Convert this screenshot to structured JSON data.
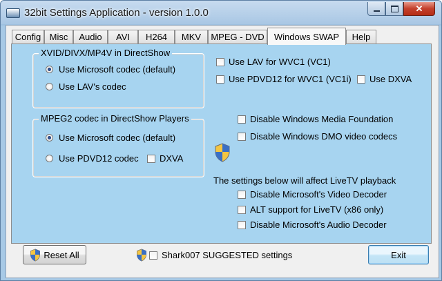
{
  "window": {
    "title": "32bit Settings Application - version 1.0.0",
    "close_label": "✕"
  },
  "tabs": [
    {
      "label": "Config"
    },
    {
      "label": "Misc"
    },
    {
      "label": "Audio"
    },
    {
      "label": "AVI"
    },
    {
      "label": "H264"
    },
    {
      "label": "MKV"
    },
    {
      "label": "MPEG - DVD"
    },
    {
      "label": "Windows SWAP",
      "active": true
    },
    {
      "label": "Help"
    }
  ],
  "xvid_group": {
    "title": "XVID/DIVX/MP4V in DirectShow",
    "options": [
      {
        "label": "Use Microsoft codec (default)",
        "selected": true
      },
      {
        "label": "Use LAV's codec",
        "selected": false
      }
    ]
  },
  "mpeg2_group": {
    "title": "MPEG2 codec in DirectShow Players",
    "options": [
      {
        "label": "Use Microsoft codec (default)",
        "selected": true
      },
      {
        "label": "Use PDVD12 codec",
        "selected": false
      }
    ],
    "dxva_label": "DXVA"
  },
  "wvc1": {
    "lav_label": "Use LAV for WVC1 (VC1)",
    "pdvd_label": "Use PDVD12 for WVC1 (VC1i)",
    "dxva_label": "Use DXVA"
  },
  "media": {
    "disable_wmf_label": "Disable Windows Media Foundation",
    "disable_dmo_label": "Disable Windows DMO video codecs"
  },
  "livetv": {
    "heading": "The settings below will affect LiveTV playback",
    "disable_video_label": "Disable Microsoft's Video Decoder",
    "alt_support_label": "ALT support for LiveTV (x86 only)",
    "disable_audio_label": "Disable Microsoft's Audio Decoder"
  },
  "footer": {
    "reset_label": "Reset All",
    "suggested_label": "Shark007 SUGGESTED settings",
    "exit_label": "Exit"
  }
}
